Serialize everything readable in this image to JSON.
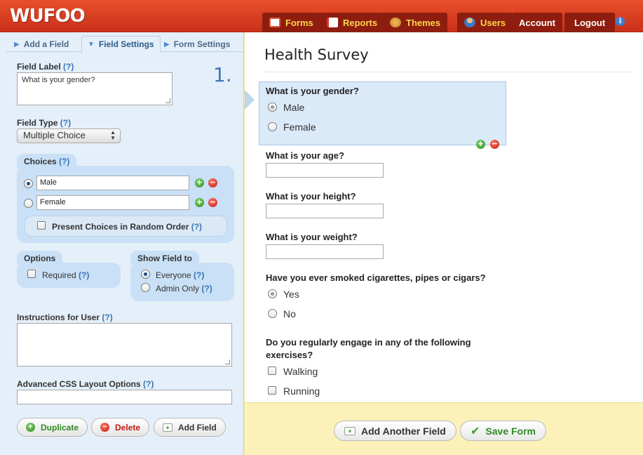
{
  "app": {
    "logo": "WUFOO"
  },
  "nav": {
    "forms": "Forms",
    "reports": "Reports",
    "themes": "Themes",
    "users": "Users",
    "account": "Account",
    "logout": "Logout",
    "info": "i"
  },
  "sidebar": {
    "tabs": {
      "add_field": "Add a Field",
      "field_settings": "Field Settings",
      "form_settings": "Form Settings"
    },
    "field_number": "1.",
    "field_label": {
      "label": "Field Label",
      "help": "(?)",
      "value": "What is your gender?"
    },
    "field_type": {
      "label": "Field Type",
      "help": "(?)",
      "value": "Multiple Choice"
    },
    "choices": {
      "label": "Choices",
      "help": "(?)",
      "items": [
        {
          "value": "Male",
          "selected": true
        },
        {
          "value": "Female",
          "selected": false
        }
      ],
      "random": {
        "label": "Present Choices in Random Order",
        "help": "(?)"
      }
    },
    "options": {
      "label": "Options",
      "required": "Required",
      "help": "(?)"
    },
    "show_field": {
      "label": "Show Field to",
      "everyone": "Everyone",
      "admin_only": "Admin Only",
      "help": "(?)"
    },
    "instructions": {
      "label": "Instructions for User",
      "help": "(?)"
    },
    "css_layout": {
      "label": "Advanced CSS Layout Options",
      "help": "(?)"
    },
    "buttons": {
      "duplicate": "Duplicate",
      "delete": "Delete",
      "add_field": "Add Field"
    }
  },
  "form": {
    "title": "Health Survey",
    "questions": [
      {
        "label": "What is your gender?",
        "options": [
          "Male",
          "Female"
        ]
      },
      {
        "label": "What is your age?"
      },
      {
        "label": "What is your height?"
      },
      {
        "label": "What is your weight?"
      },
      {
        "label": "Have you ever smoked cigarettes, pipes or cigars?",
        "options": [
          "Yes",
          "No"
        ]
      },
      {
        "label_line1": "Do you regularly engage in any of the following",
        "label_line2": "exercises?",
        "options": [
          "Walking",
          "Running"
        ]
      }
    ]
  },
  "footer": {
    "add_another": "Add Another Field",
    "save": "Save Form"
  },
  "colors": {
    "header": "#d9401f",
    "nav_tab": "#8e1d0f",
    "sidebar": "#e4eff9",
    "selected_field": "#dbeaf9",
    "footer": "#fcf1b8",
    "accent_blue": "#3f78b9"
  }
}
